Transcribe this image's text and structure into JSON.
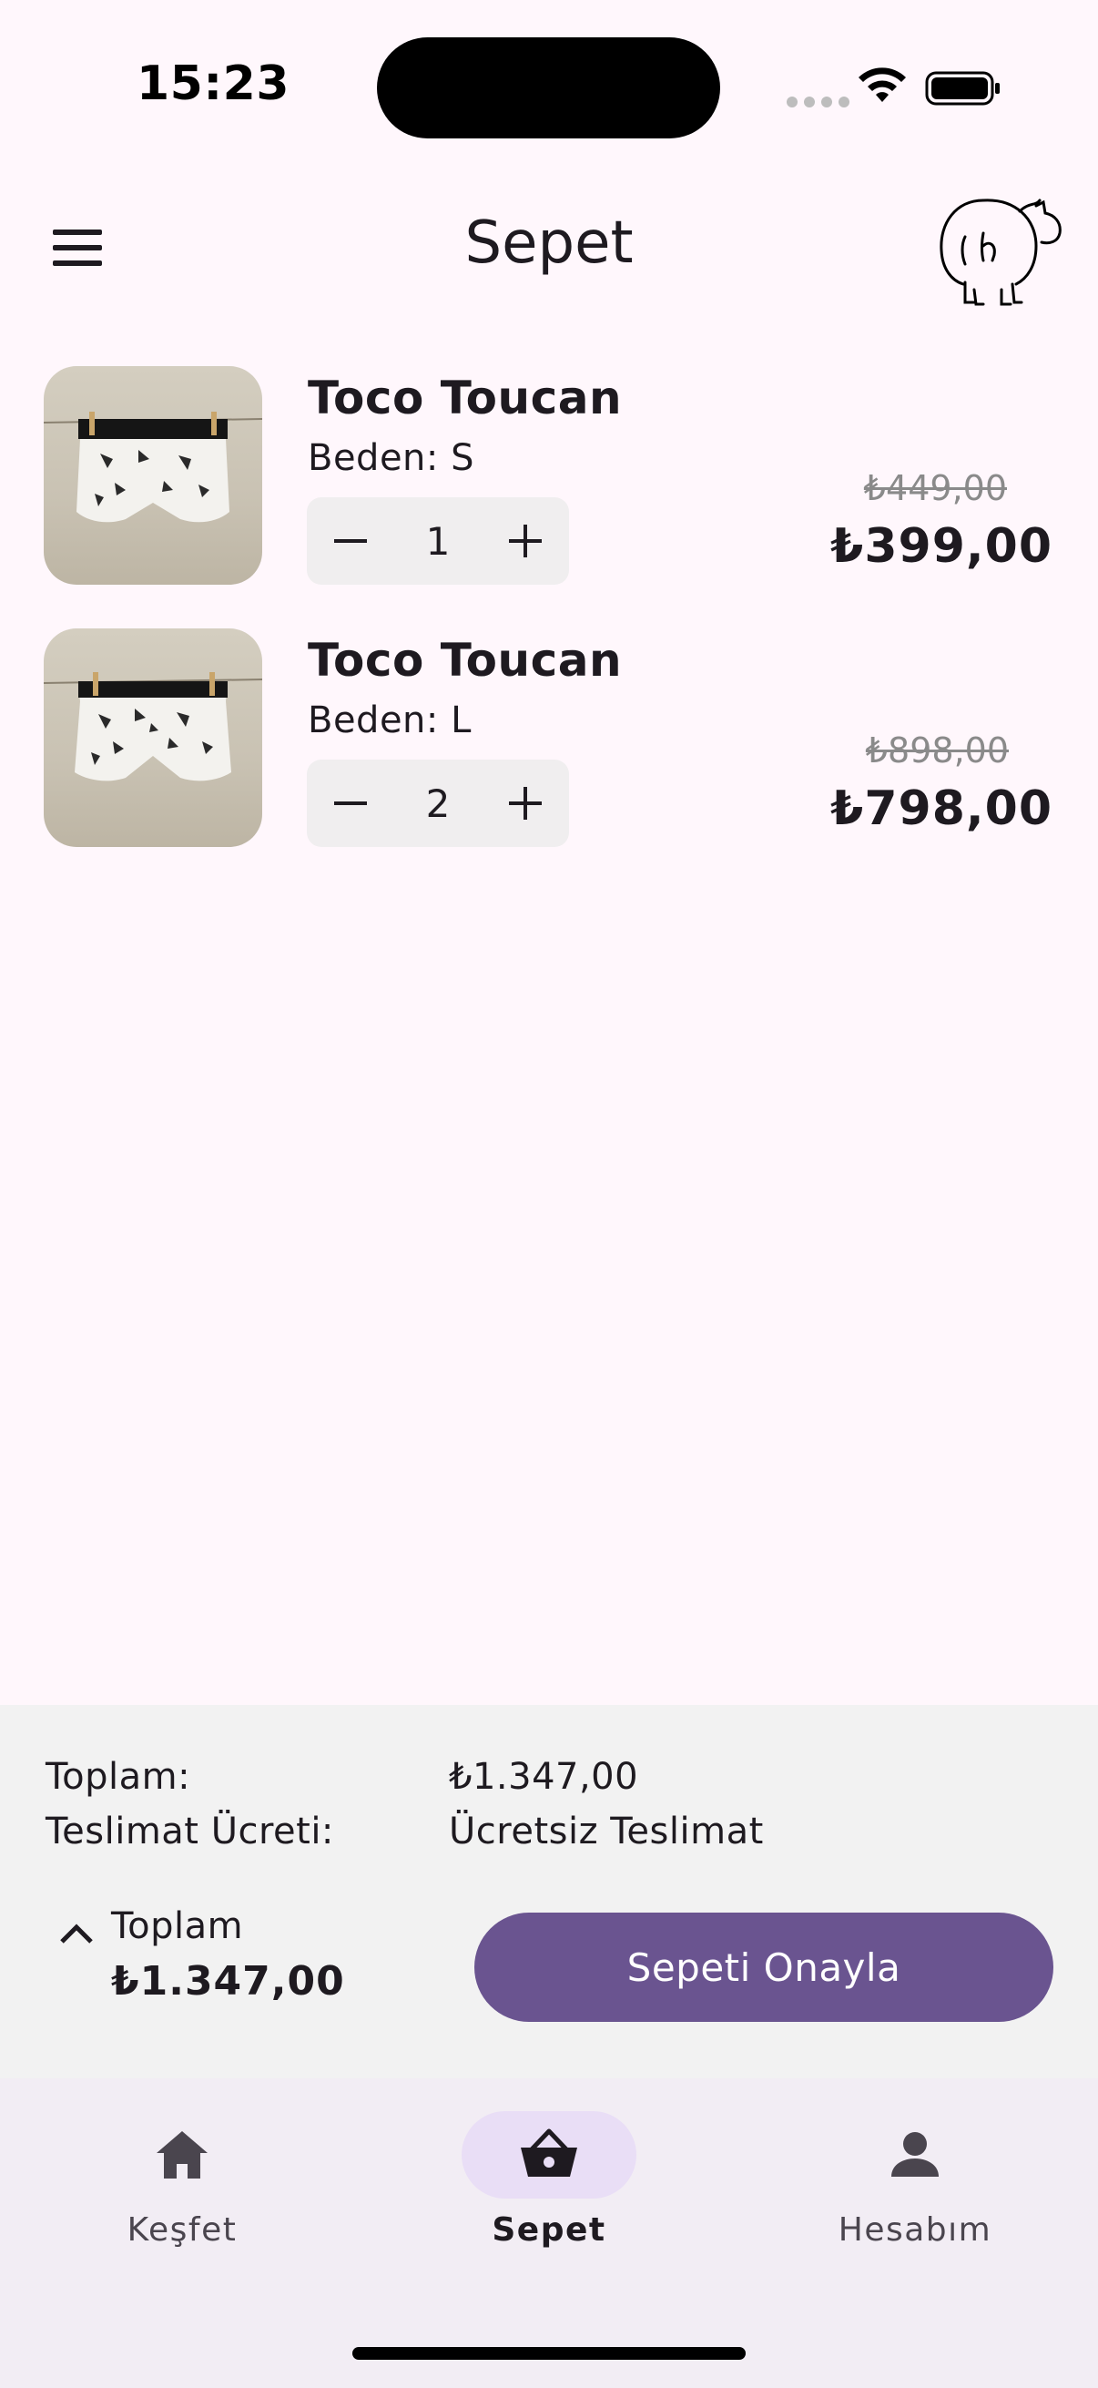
{
  "status_bar": {
    "time": "15:23"
  },
  "app_bar": {
    "title": "Sepet",
    "menu_icon": "hamburger-menu-icon",
    "logo_icon": "brand-logo-icon"
  },
  "cart": {
    "items": [
      {
        "name": "Toco Toucan",
        "size": "Beden: S",
        "quantity": "1",
        "old_price": "₺449,00",
        "price": "₺399,00"
      },
      {
        "name": "Toco Toucan",
        "size": "Beden: L",
        "quantity": "2",
        "old_price": "₺898,00",
        "price": "₺798,00"
      }
    ]
  },
  "summary": {
    "subtotal_label": "Toplam:",
    "subtotal_value": "₺1.347,00",
    "shipping_label": "Teslimat Ücreti:",
    "shipping_value": "Ücretsiz Teslimat",
    "total_caption": "Toplam",
    "total_amount": "₺1.347,00",
    "confirm_label": "Sepeti Onayla"
  },
  "bottom_nav": {
    "items": [
      {
        "label": "Keşfet",
        "icon": "home-icon",
        "active": false
      },
      {
        "label": "Sepet",
        "icon": "basket-icon",
        "active": true
      },
      {
        "label": "Hesabım",
        "icon": "person-icon",
        "active": false
      }
    ]
  },
  "colors": {
    "background": "#FFF7FC",
    "primary": "#6A5490",
    "nav_active_pill": "#E9DEF6",
    "summary_panel": "#F2F2F2"
  }
}
